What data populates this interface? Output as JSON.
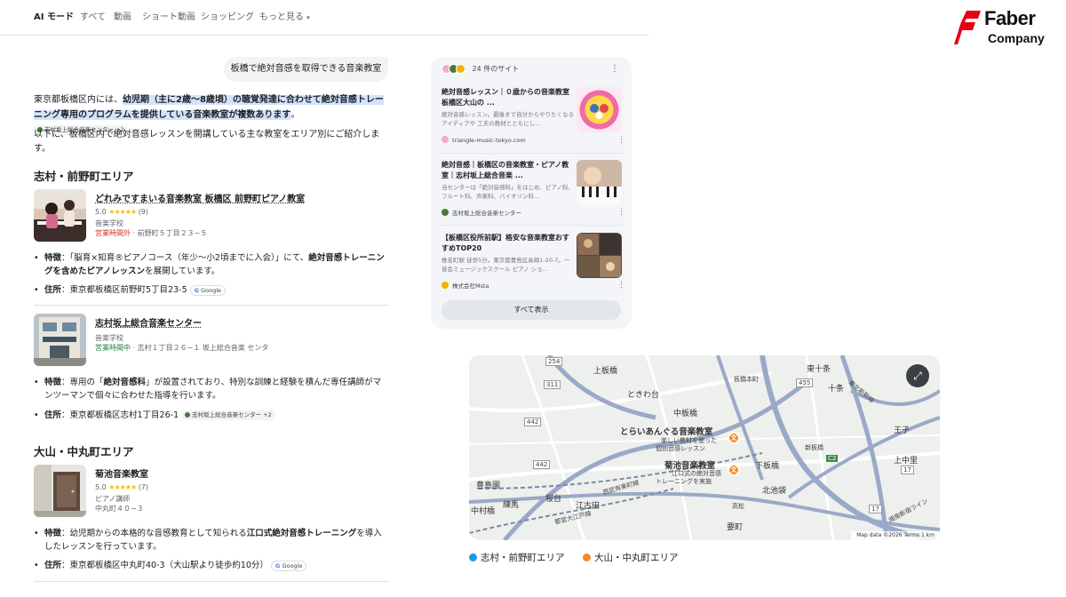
{
  "nav": {
    "tabs": [
      "AI モード",
      "すべて",
      "動画",
      "ショート動画",
      "ショッピング",
      "もっと見る"
    ]
  },
  "logo": {
    "line1": "Faber",
    "line2": "Company",
    "brand_color": "#e60012"
  },
  "query": "板橋で絶対音感を取得できる音楽教室",
  "intro": {
    "pre": "東京都板橋区内には、",
    "highlight": "幼児期（主に2歳〜8歳頃）の聴覚発達に合わせて絶対音感トレーニング専用のプログラムを提供している音楽教室が複数あります",
    "post": "。",
    "chip": "志村坂上総合音楽センター +2"
  },
  "para2": "以下に、板橋区内で絶対音感レッスンを開講している主な教室をエリア別にご紹介します。",
  "areas": [
    {
      "heading": "志村・前野町エリア",
      "businesses": [
        {
          "name": "どれみですまいる音楽教室 板橋区 前野町ピアノ教室",
          "rating": "5.0",
          "stars": "★★★★★",
          "reviews": "(9)",
          "category": "音楽学校",
          "status": "営業時間外",
          "address": "前野町５丁目２３−５",
          "feature_label": "特徴",
          "feature": "：「脳育×知育®ピアノコース（年少〜小2頃までに入会）」にて、",
          "feature_bold": "絶対音感トレーニングを含めたピアノレッスン",
          "feature_post": "を展開しています。",
          "addr_label": "住所",
          "addr_full": "：東京都板橋区前野町5丁目23-5",
          "chip": "Google"
        },
        {
          "name": "志村坂上総合音楽センター",
          "category": "音楽学校",
          "status": "営業時間中",
          "address": "志村１丁目２６−１ 坂上総合音楽 センタ",
          "feature_label": "特徴",
          "feature": "：専用の「",
          "feature_bold": "絶対音感科",
          "feature_post": "」が設置されており、特別な訓練と経験を積んだ専任講師がマンツーマンで個々に合わせた指導を行います。",
          "addr_label": "住所",
          "addr_full": "：東京都板橋区志村1丁目26-1",
          "chip": "志村坂上総合音楽センター +2"
        }
      ]
    },
    {
      "heading": "大山・中丸町エリア",
      "businesses": [
        {
          "name": "菊池音楽教室",
          "rating": "5.0",
          "stars": "★★★★★",
          "reviews": "(7)",
          "category": "ピアノ講師",
          "address": "中丸町４０−３",
          "feature_label": "特徴",
          "feature": "：幼児期からの本格的な音感教育として知られる",
          "feature_bold": "江口式絶対音感トレーニング",
          "feature_post": "を導入したレッスンを行っています。",
          "addr_label": "住所",
          "addr_full": "：東京都板橋区中丸町40-3（大山駅より徒歩約10分）",
          "chip": "Google"
        }
      ]
    }
  ],
  "sites": {
    "header": "24 件のサイト",
    "cards": [
      {
        "title": "絶対音感レッスン｜０歳からの音楽教室 板橋区大山の ...",
        "desc": "絶対音感レッスン。最後まで自分からやりたくなるアイディアや 工夫の教材とともにし...",
        "source": "triangle-music-tokyo.com"
      },
      {
        "title": "絶対音感｜板橋区の音楽教室・ピアノ教室｜志村坂上総合音楽 ...",
        "desc": "当センターは「絶対音感科」をはじめ、ピアノ科、フルート科、声楽科、バイオリン科...",
        "source": "志村坂上総合音楽センター"
      },
      {
        "title": "【板橋区役所前駅】格安な音楽教室おすすめTOP20",
        "desc": "椎名町駅 徒歩5分。東京都豊島区長崎1-20-7。一音会ミュージックスクール ピアノ ショ...",
        "source": "株式会社Msta"
      }
    ],
    "show_all": "すべて表示"
  },
  "map": {
    "labels": {
      "kamiitabashi": "上板橋",
      "higashijujo": "東十条",
      "tokiwadai": "ときわ台",
      "itabashihoncho": "板橋本町",
      "jujo": "十条",
      "nakaitabashi": "中板橋",
      "shinitabashi": "新板橋",
      "oji": "王子",
      "kaminakazato": "上中里",
      "shimoitabashi": "下板橋",
      "kitaikebukuro": "北池袋",
      "toshimaen": "豊島園",
      "nerima": "練馬",
      "sakuradai": "桜台",
      "ekoda": "江古田",
      "nakamurabashi": "中村橋",
      "takamatsu": "高松",
      "kaname": "要町",
      "nishi_ikebukuro": "西武有楽町線",
      "seibu": "都営大江戸線",
      "shonan": "湘南新宿ライン",
      "tohoku": "東北新幹線"
    },
    "routes": [
      "254",
      "311",
      "455",
      "442",
      "442",
      "C2",
      "17",
      "17"
    ],
    "pins": [
      {
        "name": "とらいあんぐる音楽教室",
        "sub1": "楽しい教材を使った",
        "sub2": "個別音感レッスン"
      },
      {
        "name": "菊池音楽教室",
        "sub1": "江口式の絶対音感",
        "sub2": "トレーニングを実施"
      }
    ],
    "expand_icon": "⤢",
    "footer": "Map data ©2026   Terms   1 km"
  },
  "legend": [
    {
      "label": "志村・前野町エリア",
      "color": "#1a9be8"
    },
    {
      "label": "大山・中丸町エリア",
      "color": "#f28b25"
    }
  ]
}
